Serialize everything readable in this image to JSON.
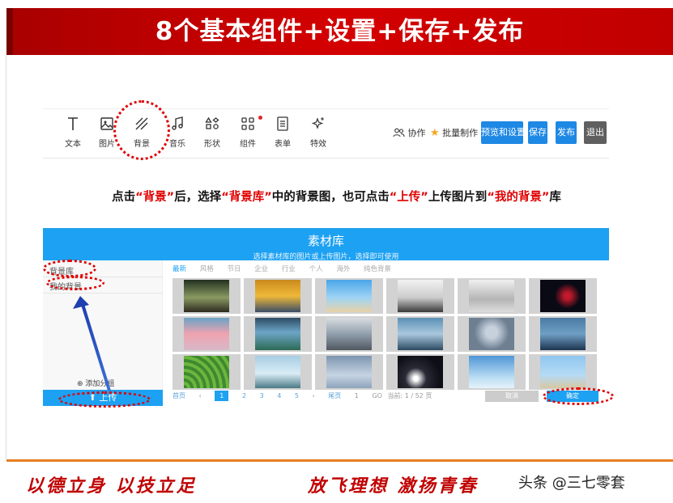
{
  "title": "8个基本组件+设置+保存+发布",
  "toolbar": {
    "tools": [
      {
        "label": "文本",
        "icon": "text-icon"
      },
      {
        "label": "图片",
        "icon": "image-icon"
      },
      {
        "label": "背景",
        "icon": "background-icon"
      },
      {
        "label": "音乐",
        "icon": "music-icon"
      },
      {
        "label": "形状",
        "icon": "shape-icon"
      },
      {
        "label": "组件",
        "icon": "component-icon"
      },
      {
        "label": "表单",
        "icon": "form-icon"
      },
      {
        "label": "特效",
        "icon": "effects-icon"
      }
    ],
    "collab_label": "协作",
    "batch_label": "批量制作",
    "preview_label": "预览和设置",
    "save_label": "保存",
    "publish_label": "发布",
    "exit_label": "退出",
    "colors": {
      "blue": "#1e88e5",
      "exit": "#5f5f5f",
      "badge": "#e4252e"
    }
  },
  "instruction": {
    "p1": "点击",
    "q1": "“背景”",
    "p2": "后，选择",
    "q2": "“背景库”",
    "p3": "中的背景图，也可点击",
    "q3": "“上传”",
    "p4": "上传图片到",
    "q4": "“我的背景”",
    "p5": "库"
  },
  "library": {
    "title": "素材库",
    "subtitle": "选择素材库的图片或上传图片，选择即可使用",
    "side": {
      "item1": "背景库",
      "item2": "我的背景",
      "add_group": "添加分组",
      "upload": "上传"
    },
    "tabs": [
      "最新",
      "风格",
      "节日",
      "企业",
      "行业",
      "个人",
      "海外",
      "纯色背景"
    ],
    "pager": {
      "first": "首页",
      "prev": "‹",
      "pages": [
        "1",
        "2",
        "3",
        "4",
        "5"
      ],
      "next": "›",
      "last": "尾页",
      "input": "1",
      "go": "GO",
      "status": "当前: 1 / 52 页"
    },
    "cancel_label": "取消",
    "ok_label": "确定",
    "accent": "#1da1f2"
  },
  "footer": {
    "slogan1": "以德立身 以技立足",
    "slogan2": "放飞理想 激扬青春",
    "watermark": "头条 @三七零套",
    "rule_color": "#e67e22"
  }
}
